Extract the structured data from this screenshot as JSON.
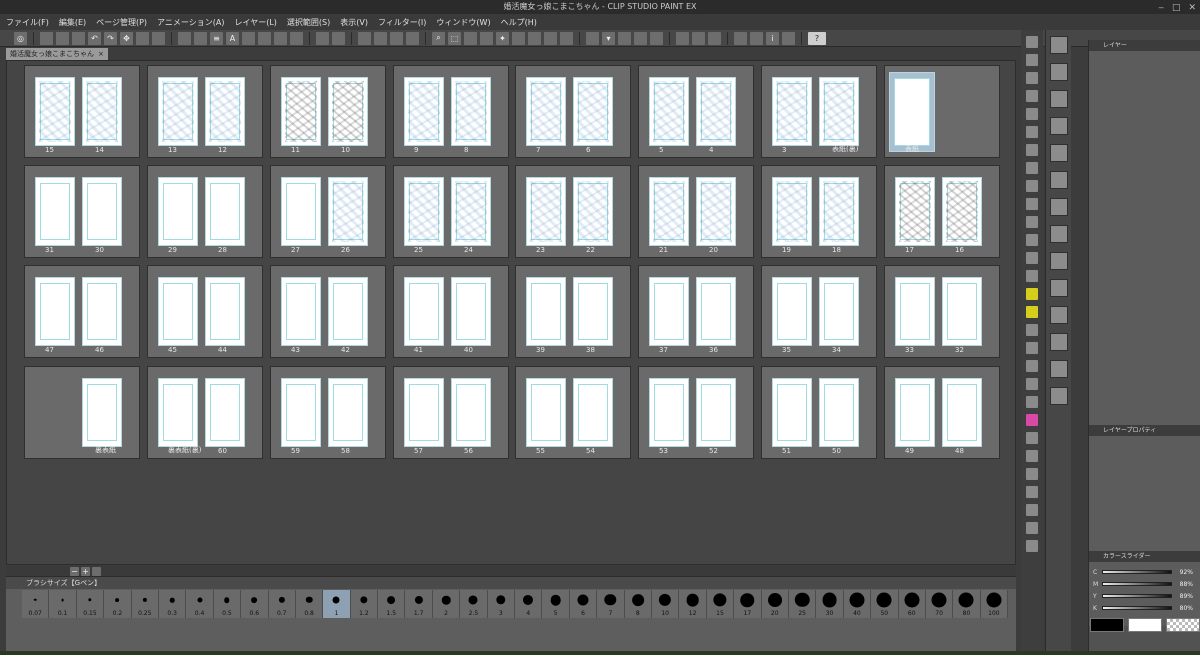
{
  "app": {
    "title": "婚活魔女っ娘こまこちゃん - CLIP STUDIO PAINT EX",
    "window_controls": [
      "‒",
      "□",
      "✕"
    ]
  },
  "menu": [
    "ファイル(F)",
    "編集(E)",
    "ページ管理(P)",
    "アニメーション(A)",
    "レイヤー(L)",
    "選択範囲(S)",
    "表示(V)",
    "フィルター(I)",
    "ウィンドウ(W)",
    "ヘルプ(H)"
  ],
  "document_tab": {
    "label": "婚活魔女っ娘こまこちゃん",
    "close": "×"
  },
  "spread_rows": [
    [
      {
        "left": "15",
        "right": "14",
        "left_ink": "blue",
        "right_ink": "blue"
      },
      {
        "left": "13",
        "right": "12",
        "left_ink": "blue",
        "right_ink": "blue"
      },
      {
        "left": "11",
        "right": "10",
        "left_ink": "dark",
        "right_ink": "dark"
      },
      {
        "left": "9",
        "right": "8",
        "left_ink": "blue",
        "right_ink": "blue"
      },
      {
        "left": "7",
        "right": "6",
        "left_ink": "blue",
        "right_ink": "blue"
      },
      {
        "left": "5",
        "right": "4",
        "left_ink": "blue",
        "right_ink": "blue"
      },
      {
        "left": "3",
        "right": "表紙(裏)",
        "left_ink": "blue",
        "right_ink": "blue"
      },
      {
        "left": "表紙",
        "right": "",
        "left_ink": "none",
        "right_ink": "none",
        "selected": true
      }
    ],
    [
      {
        "left": "31",
        "right": "30",
        "left_ink": "none",
        "right_ink": "none"
      },
      {
        "left": "29",
        "right": "28",
        "left_ink": "none",
        "right_ink": "none"
      },
      {
        "left": "27",
        "right": "26",
        "left_ink": "none",
        "right_ink": "blue"
      },
      {
        "left": "25",
        "right": "24",
        "left_ink": "blue",
        "right_ink": "blue"
      },
      {
        "left": "23",
        "right": "22",
        "left_ink": "blue",
        "right_ink": "blue"
      },
      {
        "left": "21",
        "right": "20",
        "left_ink": "blue",
        "right_ink": "blue"
      },
      {
        "left": "19",
        "right": "18",
        "left_ink": "blue",
        "right_ink": "blue"
      },
      {
        "left": "17",
        "right": "16",
        "left_ink": "dark",
        "right_ink": "dark"
      }
    ],
    [
      {
        "left": "47",
        "right": "46",
        "left_ink": "none",
        "right_ink": "none"
      },
      {
        "left": "45",
        "right": "44",
        "left_ink": "none",
        "right_ink": "none"
      },
      {
        "left": "43",
        "right": "42",
        "left_ink": "none",
        "right_ink": "none"
      },
      {
        "left": "41",
        "right": "40",
        "left_ink": "none",
        "right_ink": "none"
      },
      {
        "left": "39",
        "right": "38",
        "left_ink": "none",
        "right_ink": "none"
      },
      {
        "left": "37",
        "right": "36",
        "left_ink": "none",
        "right_ink": "none"
      },
      {
        "left": "35",
        "right": "34",
        "left_ink": "none",
        "right_ink": "none"
      },
      {
        "left": "33",
        "right": "32",
        "left_ink": "none",
        "right_ink": "none"
      }
    ],
    [
      {
        "left": "",
        "right": "裏表紙",
        "left_ink": "empty",
        "right_ink": "none"
      },
      {
        "left": "裏表紙(裏)",
        "right": "60",
        "left_ink": "none",
        "right_ink": "none"
      },
      {
        "left": "59",
        "right": "58",
        "left_ink": "none",
        "right_ink": "none"
      },
      {
        "left": "57",
        "right": "56",
        "left_ink": "none",
        "right_ink": "none"
      },
      {
        "left": "55",
        "right": "54",
        "left_ink": "none",
        "right_ink": "none"
      },
      {
        "left": "53",
        "right": "52",
        "left_ink": "none",
        "right_ink": "none"
      },
      {
        "left": "51",
        "right": "50",
        "left_ink": "none",
        "right_ink": "none"
      },
      {
        "left": "49",
        "right": "48",
        "left_ink": "none",
        "right_ink": "none"
      }
    ]
  ],
  "brush_panel": {
    "title": "ブラシサイズ【Gペン】",
    "sizes": [
      "0.07",
      "0.1",
      "0.15",
      "0.2",
      "0.25",
      "0.3",
      "0.4",
      "0.5",
      "0.6",
      "0.7",
      "0.8",
      "1",
      "1.2",
      "1.5",
      "1.7",
      "2",
      "2.5",
      "3",
      "4",
      "5",
      "6",
      "7",
      "8",
      "10",
      "12",
      "15",
      "17",
      "20",
      "25",
      "30",
      "40",
      "50",
      "60",
      "70",
      "80",
      "100"
    ],
    "selected": "1"
  },
  "right_panels": {
    "layer_tab": "レイヤー",
    "layer_property_tab": "レイヤープロパティ",
    "color_slider_tab": "カラースライダー",
    "cmyk": [
      {
        "channel": "C",
        "value": "92%"
      },
      {
        "channel": "M",
        "value": "88%"
      },
      {
        "channel": "Y",
        "value": "89%"
      },
      {
        "channel": "K",
        "value": "80%"
      }
    ]
  },
  "colors": {
    "main_color": "#000000",
    "sub_color": "#ffffff",
    "selected_page": "#a9bed0"
  }
}
